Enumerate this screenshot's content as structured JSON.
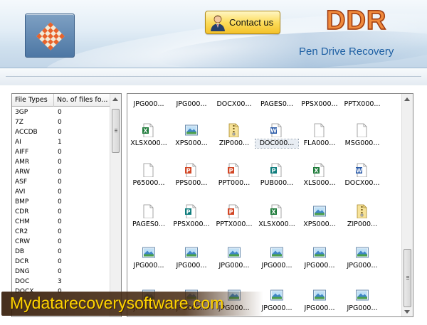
{
  "header": {
    "contact_label": "Contact us",
    "brand": "DDR",
    "product_title": "Pen Drive Recovery"
  },
  "left_panel": {
    "columns": [
      "File Types",
      "No. of files fo..."
    ],
    "rows": [
      [
        "3GP",
        "0"
      ],
      [
        "7Z",
        "0"
      ],
      [
        "ACCDB",
        "0"
      ],
      [
        "AI",
        "1"
      ],
      [
        "AIFF",
        "0"
      ],
      [
        "AMR",
        "0"
      ],
      [
        "ARW",
        "0"
      ],
      [
        "ASF",
        "0"
      ],
      [
        "AVI",
        "0"
      ],
      [
        "BMP",
        "0"
      ],
      [
        "CDR",
        "0"
      ],
      [
        "CHM",
        "0"
      ],
      [
        "CR2",
        "0"
      ],
      [
        "CRW",
        "0"
      ],
      [
        "DB",
        "0"
      ],
      [
        "DCR",
        "0"
      ],
      [
        "DNG",
        "0"
      ],
      [
        "DOC",
        "3"
      ],
      [
        "DOCX",
        "0"
      ]
    ]
  },
  "files": [
    {
      "name": "JPG000...",
      "icon": "image-file-icon"
    },
    {
      "name": "JPG000...",
      "icon": "image-file-icon"
    },
    {
      "name": "DOCX00...",
      "icon": "word-file-icon"
    },
    {
      "name": "PAGES0...",
      "icon": "blank-file-icon"
    },
    {
      "name": "PPSX000...",
      "icon": "powerpoint-file-icon"
    },
    {
      "name": "PPTX000...",
      "icon": "powerpoint-file-icon"
    },
    {
      "name": "XLSX000...",
      "icon": "excel-file-icon"
    },
    {
      "name": "XPS000...",
      "icon": "image-file-icon"
    },
    {
      "name": "ZIP000...",
      "icon": "zip-file-icon"
    },
    {
      "name": "DOC000...",
      "icon": "word-file-icon"
    },
    {
      "name": "FLA000...",
      "icon": "blank-file-icon"
    },
    {
      "name": "MSG000...",
      "icon": "blank-file-icon"
    },
    {
      "name": "P65000...",
      "icon": "blank-file-icon"
    },
    {
      "name": "PPS000...",
      "icon": "powerpoint-file-icon"
    },
    {
      "name": "PPT000...",
      "icon": "powerpoint-file-icon"
    },
    {
      "name": "PUB000...",
      "icon": "publisher-file-icon"
    },
    {
      "name": "XLS000...",
      "icon": "excel-file-icon"
    },
    {
      "name": "DOCX00...",
      "icon": "word-file-icon"
    },
    {
      "name": "PAGES0...",
      "icon": "blank-file-icon"
    },
    {
      "name": "PPSX000...",
      "icon": "publisher-file-icon"
    },
    {
      "name": "PPTX000...",
      "icon": "powerpoint-file-icon"
    },
    {
      "name": "XLSX000...",
      "icon": "excel-file-icon"
    },
    {
      "name": "XPS000...",
      "icon": "image-file-icon"
    },
    {
      "name": "ZIP000...",
      "icon": "zip-file-icon"
    },
    {
      "name": "JPG000...",
      "icon": "image-file-icon"
    },
    {
      "name": "JPG000...",
      "icon": "image-file-icon"
    },
    {
      "name": "JPG000...",
      "icon": "image-file-icon"
    },
    {
      "name": "JPG000...",
      "icon": "image-file-icon"
    },
    {
      "name": "JPG000...",
      "icon": "image-file-icon"
    },
    {
      "name": "JPG000...",
      "icon": "image-file-icon"
    },
    {
      "name": "JPG000...",
      "icon": "image-file-icon"
    },
    {
      "name": "JPG000...",
      "icon": "image-file-icon"
    },
    {
      "name": "JPG000...",
      "icon": "image-file-icon"
    },
    {
      "name": "JPG000...",
      "icon": "image-file-icon"
    },
    {
      "name": "JPG000...",
      "icon": "image-file-icon"
    },
    {
      "name": "JPG000...",
      "icon": "image-file-icon"
    }
  ],
  "selected_file": "DOC000...",
  "watermark": "Mydatarecoverysoftware.com",
  "colors": {
    "brand_orange": "#f08a3c",
    "title_blue": "#1d5fa3",
    "contact_gold": "#fcdc5c",
    "watermark_yellow": "#ffd400"
  }
}
